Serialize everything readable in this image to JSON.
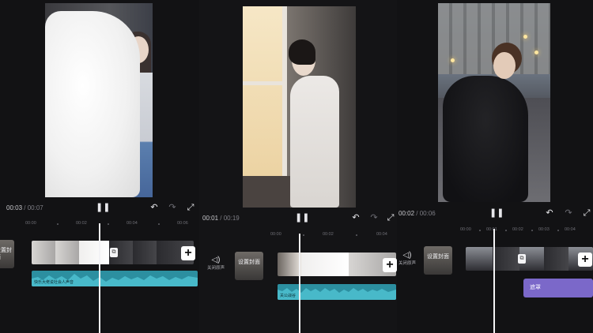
{
  "panels": [
    {
      "time_current": "00:03",
      "time_total": "/ 00:07",
      "ruler": [
        "00:00",
        "00:02",
        "00:04",
        "00:06"
      ],
      "cover_label": "设置封面",
      "audio_label": "快乐大佬说社会人声音",
      "icons": [
        "play-pause-icon",
        "undo-icon",
        "redo-icon",
        "fullscreen-icon",
        "add-icon"
      ]
    },
    {
      "time_current": "00:01",
      "time_total": "/ 00:19",
      "ruler": [
        "00:00",
        "00:02",
        "00:04"
      ],
      "mute_label": "关闭原声",
      "cover_label": "设置封面",
      "audio_label": "关公战谷",
      "icons": [
        "play-pause-icon",
        "undo-icon",
        "redo-icon",
        "fullscreen-icon",
        "add-icon"
      ]
    },
    {
      "time_current": "00:02",
      "time_total": "/ 00:06",
      "ruler": [
        "00:00",
        "00:01",
        "00:02",
        "00:03",
        "00:04"
      ],
      "mute_label": "关闭原声",
      "cover_label": "设置封面",
      "effect_label": "遮罩",
      "icons": [
        "play-pause-icon",
        "undo-icon",
        "redo-icon",
        "fullscreen-icon",
        "add-icon"
      ]
    }
  ],
  "colors": {
    "background": "#121214",
    "audio_track": "#2c8fa0",
    "effect_track": "#7b68c9",
    "playhead": "#f3f3f5"
  }
}
